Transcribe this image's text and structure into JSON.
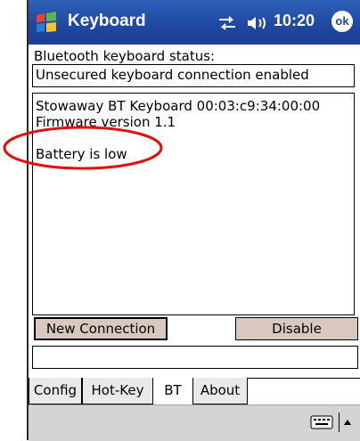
{
  "app": {
    "title": "Keyboard",
    "clock": "10:20",
    "ok_label": "ok"
  },
  "status_label": "Bluetooth keyboard status:",
  "status_value": "Unsecured keyboard connection enabled",
  "info": {
    "line1": "Stowaway BT Keyboard 00:03:c9:34:00:00",
    "line2": "Firmware version 1.1",
    "line3": "Battery is low"
  },
  "buttons": {
    "new_connection": "New Connection",
    "disable": "Disable"
  },
  "tabs": [
    {
      "label": "Config"
    },
    {
      "label": "Hot-Key"
    },
    {
      "label": "BT",
      "active": true
    },
    {
      "label": "About"
    }
  ],
  "icons": {
    "start": "windows-flag-icon",
    "connectivity": "connectivity-arrows-icon",
    "volume": "speaker-icon",
    "keyboard": "keyboard-icon",
    "input_arrow": "up-arrow-icon"
  },
  "colors": {
    "titlebar": "#1f47a0",
    "button": "#d8c8c0",
    "annotation": "#e01010"
  }
}
